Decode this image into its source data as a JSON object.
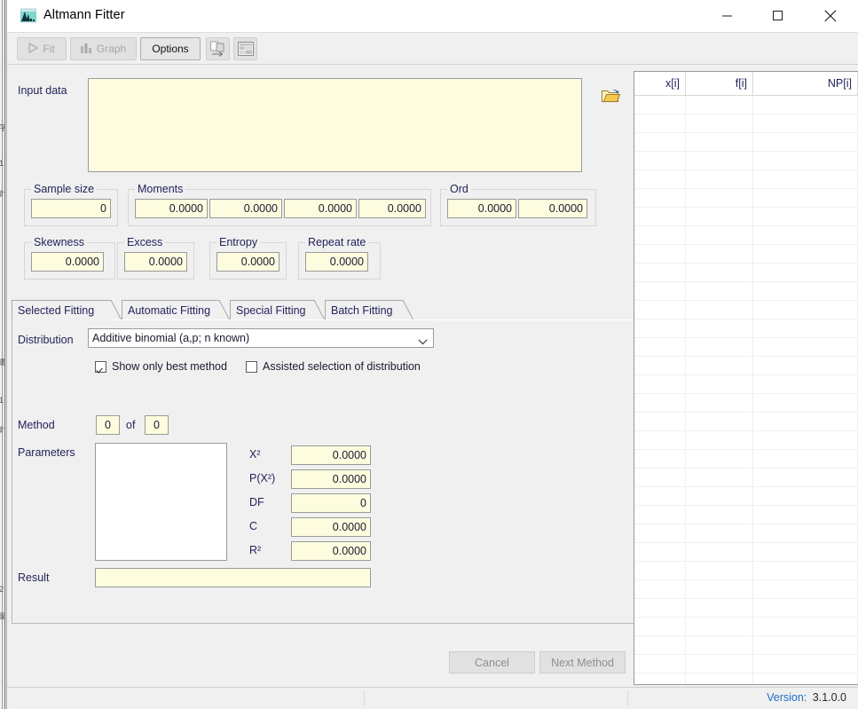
{
  "window": {
    "title": "Altmann Fitter",
    "app_icon": "histogram-icon",
    "controls": {
      "minimize": "minimize-icon",
      "maximize": "maximize-icon",
      "close": "close-icon"
    }
  },
  "toolbar": {
    "fit_label": "Fit",
    "graph_label": "Graph",
    "options_label": "Options",
    "copy_icon": "copy-export-icon",
    "table_icon": "table-view-icon"
  },
  "input": {
    "label": "Input data",
    "value": "",
    "placeholder": "",
    "open_icon": "folder-open-icon"
  },
  "stats_groups": [
    {
      "title": "Sample size",
      "fields": [
        {
          "name": "sample-size",
          "value": "0"
        }
      ]
    },
    {
      "title": "Moments",
      "fields": [
        {
          "name": "moment-1",
          "value": "0.0000"
        },
        {
          "name": "moment-2",
          "value": "0.0000"
        },
        {
          "name": "moment-3",
          "value": "0.0000"
        },
        {
          "name": "moment-4",
          "value": "0.0000"
        }
      ]
    },
    {
      "title": "Ord",
      "fields": [
        {
          "name": "ord-1",
          "value": "0.0000"
        },
        {
          "name": "ord-2",
          "value": "0.0000"
        }
      ]
    },
    {
      "title": "Skewness",
      "fields": [
        {
          "name": "skewness",
          "value": "0.0000"
        }
      ]
    },
    {
      "title": "Excess",
      "fields": [
        {
          "name": "excess",
          "value": "0.0000"
        }
      ]
    },
    {
      "title": "Entropy",
      "fields": [
        {
          "name": "entropy",
          "value": "0.0000"
        }
      ]
    },
    {
      "title": "Repeat rate",
      "fields": [
        {
          "name": "repeat-rate",
          "value": "0.0000"
        }
      ]
    }
  ],
  "tabs": [
    {
      "label": "Selected Fitting",
      "active": true
    },
    {
      "label": "Automatic Fitting",
      "active": false
    },
    {
      "label": "Special Fitting",
      "active": false
    },
    {
      "label": "Batch Fitting",
      "active": false
    }
  ],
  "selected_fitting": {
    "distribution_label": "Distribution",
    "distribution_value": "Additive binomial (a,p; n known)",
    "distribution_chevron": "chevron-down-icon",
    "checkbox_best": {
      "label": "Show only best method",
      "checked": true
    },
    "checkbox_assisted": {
      "label": "Assisted selection of distribution",
      "checked": false
    },
    "method_label": "Method",
    "method_index": "0",
    "method_of": "of",
    "method_total": "0",
    "parameters_label": "Parameters",
    "parameters_items": [],
    "stats": [
      {
        "label": "X²",
        "value": "0.0000"
      },
      {
        "label": "P(X²)",
        "value": "0.0000"
      },
      {
        "label": "DF",
        "value": "0"
      },
      {
        "label": "C",
        "value": "0.0000"
      },
      {
        "label": "R²",
        "value": "0.0000"
      }
    ],
    "result_label": "Result",
    "result_value": "",
    "cancel_label": "Cancel",
    "next_method_label": "Next Method"
  },
  "grid": {
    "columns": [
      "x[i]",
      "f[i]",
      "NP[i]"
    ],
    "rows": []
  },
  "statusbar": {
    "left_text": "",
    "middle_text": "",
    "version_label": "Version:",
    "version_value": "3.1.0.0"
  },
  "colors": {
    "field_background": "#fdfcdf",
    "window_background": "#f0f0f0",
    "label_text": "#23235c",
    "version_label": "#1b6fc4",
    "accent_folder": "#e8b23a"
  }
}
